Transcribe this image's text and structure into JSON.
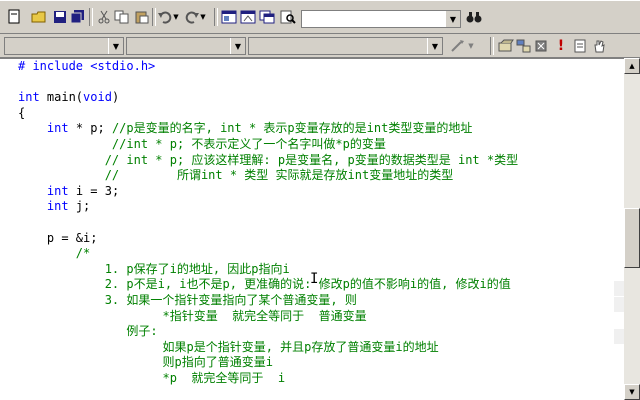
{
  "toolbar1": {
    "buttons": [
      "new-file",
      "open",
      "save",
      "save-all",
      "cut",
      "copy",
      "paste",
      "undo",
      "redo",
      "workspace",
      "output",
      "window-list",
      "find-in-files"
    ],
    "find_combo_value": ""
  },
  "toolbar2": {
    "combo_values": [
      "",
      "",
      ""
    ]
  },
  "code": {
    "lines": [
      [
        {
          "t": "# include <stdio.h>",
          "c": "kw"
        }
      ],
      [
        {
          "t": "",
          "c": "tx"
        }
      ],
      [
        {
          "t": "int",
          "c": "kw"
        },
        {
          "t": " main(",
          "c": "tx"
        },
        {
          "t": "void",
          "c": "kw"
        },
        {
          "t": ")",
          "c": "tx"
        }
      ],
      [
        {
          "t": "{",
          "c": "tx"
        }
      ],
      [
        {
          "t": "    ",
          "c": "tx"
        },
        {
          "t": "int",
          "c": "kw"
        },
        {
          "t": " * p; ",
          "c": "tx"
        },
        {
          "t": "//p是变量的名字, int * 表示p变量存放的是int类型变量的地址",
          "c": "cm"
        }
      ],
      [
        {
          "t": "             //int * p; 不表示定义了一个名字叫做*p的变量",
          "c": "cm"
        }
      ],
      [
        {
          "t": "            // int * p; 应该这样理解: p是变量名, p变量的数据类型是 int *类型",
          "c": "cm"
        }
      ],
      [
        {
          "t": "            //        所谓int * 类型 实际就是存放int变量地址的类型",
          "c": "cm"
        }
      ],
      [
        {
          "t": "    ",
          "c": "tx"
        },
        {
          "t": "int",
          "c": "kw"
        },
        {
          "t": " i = 3;",
          "c": "tx"
        }
      ],
      [
        {
          "t": "    ",
          "c": "tx"
        },
        {
          "t": "int",
          "c": "kw"
        },
        {
          "t": " j;",
          "c": "tx"
        }
      ],
      [
        {
          "t": "",
          "c": "tx"
        }
      ],
      [
        {
          "t": "    p = &i;",
          "c": "tx"
        }
      ],
      [
        {
          "t": "        /*",
          "c": "cm"
        }
      ],
      [
        {
          "t": "            1. p保存了i的地址, 因此p指向i",
          "c": "cm"
        }
      ],
      [
        {
          "t": "            2. p不是i, i也不是p, 更准确的说: 修改p的值不影响i的值, 修改i的值",
          "c": "cm"
        }
      ],
      [
        {
          "t": "            3. 如果一个指针变量指向了某个普通变量, 则",
          "c": "cm"
        }
      ],
      [
        {
          "t": "                    *指针变量  就完全等同于  普通变量",
          "c": "cm"
        }
      ],
      [
        {
          "t": "               例子:",
          "c": "cm"
        }
      ],
      [
        {
          "t": "                    如果p是个指针变量, 并且p存放了普通变量i的地址",
          "c": "cm"
        }
      ],
      [
        {
          "t": "                    则p指向了普通变量i",
          "c": "cm"
        }
      ],
      [
        {
          "t": "                    *p  就完全等同于  i",
          "c": "cm"
        }
      ]
    ]
  }
}
